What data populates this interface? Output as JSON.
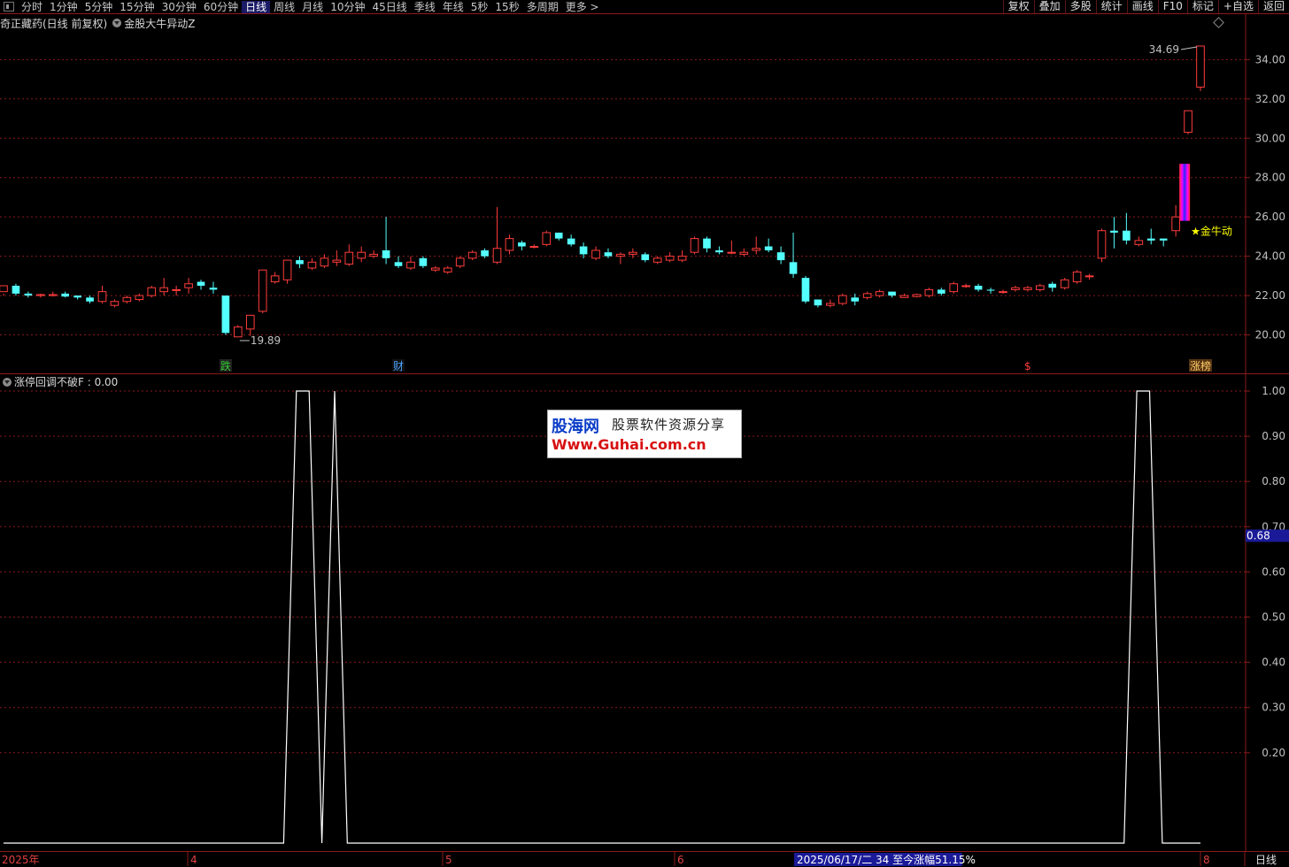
{
  "toolbar": {
    "periods": [
      "分时",
      "1分钟",
      "5分钟",
      "15分钟",
      "30分钟",
      "60分钟",
      "日线",
      "周线",
      "月线",
      "10分钟",
      "45日线",
      "季线",
      "年线",
      "5秒",
      "15秒",
      "多周期",
      "更多 >"
    ],
    "active_period": "日线",
    "right_buttons": [
      "复权",
      "叠加",
      "多股",
      "统计",
      "画线",
      "F10",
      "标记",
      "+自选",
      "返回"
    ]
  },
  "header": {
    "stock": "奇正藏药(日线 前复权)",
    "indicator": "金股大牛异动Z"
  },
  "sub_indicator": {
    "label": "涨停回调不破F : 0.00"
  },
  "watermark": {
    "line1_brand": "股海网",
    "line1_text": "股票软件资源分享",
    "line2": "Www.Guhai.com.cn"
  },
  "bottom_bar": {
    "year_label": "2025年",
    "months": [
      "4",
      "5",
      "6",
      "8"
    ],
    "status": "2025/06/17/二 34 至今涨幅51.15%",
    "period": "日线"
  },
  "colors": {
    "up": "#ff3c3c",
    "down": "#54ffff",
    "grid": "#8a1a1a",
    "axis_text": "#c0c0c0",
    "annotation_yellow": "#ffff00"
  },
  "chart_data": [
    {
      "type": "candlestick",
      "title": "奇正藏药(日线 前复权)",
      "y_ticks": [
        "34.00",
        "32.00",
        "30.00",
        "28.00",
        "26.00",
        "24.00",
        "22.00",
        "20.00"
      ],
      "ylim": [
        18.9,
        35.5
      ],
      "grid": true,
      "annotations": {
        "high_label": "34.69",
        "low_label": "19.89",
        "signal_label": "★金牛动",
        "markers": [
          "跌",
          "财",
          "$",
          "涨榜"
        ]
      },
      "candles": [
        [
          22.2,
          22.5,
          22.0,
          22.1
        ],
        [
          22.5,
          22.1,
          22.0,
          22.6
        ],
        [
          22.1,
          22.0,
          21.9,
          22.2
        ],
        [
          22.0,
          22.05,
          21.9,
          22.1
        ],
        [
          22.0,
          22.05,
          21.95,
          22.2
        ],
        [
          22.1,
          21.95,
          21.9,
          22.2
        ],
        [
          22.0,
          21.9,
          21.8,
          22.0
        ],
        [
          21.9,
          21.7,
          21.6,
          22.0
        ],
        [
          21.7,
          22.2,
          21.6,
          22.5
        ],
        [
          21.5,
          21.7,
          21.4,
          21.8
        ],
        [
          21.7,
          21.9,
          21.6,
          22.0
        ],
        [
          21.8,
          22.0,
          21.7,
          22.1
        ],
        [
          22.0,
          22.4,
          21.9,
          22.5
        ],
        [
          22.2,
          22.4,
          22.0,
          22.9
        ],
        [
          22.3,
          22.3,
          22.0,
          22.5
        ],
        [
          22.4,
          22.6,
          22.1,
          22.9
        ],
        [
          22.7,
          22.5,
          22.3,
          22.8
        ],
        [
          22.4,
          22.3,
          22.1,
          22.7
        ],
        [
          22.0,
          20.1,
          20.0,
          22.0
        ],
        [
          19.9,
          20.4,
          19.89,
          20.5
        ],
        [
          20.3,
          21.0,
          19.95,
          21.0
        ],
        [
          21.2,
          23.3,
          21.1,
          23.3
        ],
        [
          22.7,
          23.0,
          22.6,
          23.2
        ],
        [
          22.8,
          23.8,
          22.6,
          23.8
        ],
        [
          23.8,
          23.6,
          23.4,
          24.0
        ],
        [
          23.4,
          23.7,
          23.3,
          23.9
        ],
        [
          23.5,
          23.9,
          23.4,
          24.1
        ],
        [
          23.7,
          23.8,
          23.5,
          24.3
        ],
        [
          23.6,
          24.2,
          23.5,
          24.6
        ],
        [
          23.9,
          24.2,
          23.7,
          24.5
        ],
        [
          24.0,
          24.1,
          23.9,
          24.3
        ],
        [
          24.3,
          23.9,
          23.6,
          26.0
        ],
        [
          23.7,
          23.5,
          23.4,
          24.0
        ],
        [
          23.4,
          23.7,
          23.3,
          24.0
        ],
        [
          23.9,
          23.5,
          23.4,
          24.0
        ],
        [
          23.3,
          23.4,
          23.2,
          23.5
        ],
        [
          23.2,
          23.4,
          23.1,
          23.5
        ],
        [
          23.5,
          23.9,
          23.4,
          24.0
        ],
        [
          23.9,
          24.2,
          23.8,
          24.3
        ],
        [
          24.3,
          24.0,
          23.9,
          24.4
        ],
        [
          23.7,
          24.4,
          23.6,
          26.5
        ],
        [
          24.3,
          24.9,
          24.1,
          25.1
        ],
        [
          24.7,
          24.5,
          24.3,
          24.8
        ],
        [
          24.5,
          24.5,
          24.4,
          24.6
        ],
        [
          24.6,
          25.2,
          24.5,
          25.3
        ],
        [
          25.2,
          24.9,
          24.8,
          25.2
        ],
        [
          24.9,
          24.6,
          24.5,
          25.1
        ],
        [
          24.5,
          24.1,
          23.9,
          24.7
        ],
        [
          23.9,
          24.3,
          23.8,
          24.5
        ],
        [
          24.2,
          24.0,
          23.9,
          24.4
        ],
        [
          24.0,
          24.1,
          23.6,
          24.2
        ],
        [
          24.1,
          24.2,
          23.9,
          24.4
        ],
        [
          24.1,
          23.8,
          23.7,
          24.2
        ],
        [
          23.7,
          23.9,
          23.6,
          24.0
        ],
        [
          23.8,
          24.0,
          23.7,
          24.2
        ],
        [
          23.8,
          24.0,
          23.7,
          24.3
        ],
        [
          24.2,
          24.9,
          24.1,
          25.0
        ],
        [
          24.9,
          24.4,
          24.2,
          25.0
        ],
        [
          24.3,
          24.2,
          24.1,
          24.5
        ],
        [
          24.2,
          24.2,
          24.1,
          24.8
        ],
        [
          24.1,
          24.2,
          24.0,
          24.4
        ],
        [
          24.3,
          24.4,
          24.1,
          25.0
        ],
        [
          24.5,
          24.3,
          24.2,
          24.9
        ],
        [
          24.2,
          23.8,
          23.6,
          24.5
        ],
        [
          23.7,
          23.1,
          22.9,
          25.2
        ],
        [
          22.9,
          21.7,
          21.6,
          23.0
        ],
        [
          21.8,
          21.5,
          21.4,
          21.7
        ],
        [
          21.5,
          21.6,
          21.4,
          21.8
        ],
        [
          21.6,
          22.0,
          21.5,
          22.1
        ],
        [
          21.9,
          21.7,
          21.5,
          22.1
        ],
        [
          21.9,
          22.1,
          21.8,
          22.2
        ],
        [
          22.0,
          22.2,
          21.9,
          22.3
        ],
        [
          22.2,
          22.0,
          21.9,
          22.2
        ],
        [
          21.9,
          22.0,
          21.9,
          22.1
        ],
        [
          21.95,
          22.05,
          21.9,
          22.1
        ],
        [
          22.0,
          22.3,
          21.9,
          22.4
        ],
        [
          22.3,
          22.1,
          22.0,
          22.4
        ],
        [
          22.2,
          22.6,
          22.1,
          22.7
        ],
        [
          22.5,
          22.5,
          22.4,
          22.6
        ],
        [
          22.5,
          22.3,
          22.2,
          22.6
        ],
        [
          22.3,
          22.25,
          22.1,
          22.4
        ],
        [
          22.2,
          22.2,
          22.1,
          22.3
        ],
        [
          22.3,
          22.4,
          22.2,
          22.5
        ],
        [
          22.3,
          22.4,
          22.2,
          22.5
        ],
        [
          22.3,
          22.5,
          22.2,
          22.6
        ],
        [
          22.6,
          22.4,
          22.2,
          22.7
        ],
        [
          22.4,
          22.8,
          22.3,
          22.9
        ],
        [
          22.7,
          23.2,
          22.6,
          23.3
        ],
        [
          23.0,
          23.0,
          22.8,
          23.1
        ],
        [
          23.9,
          25.3,
          23.7,
          25.4
        ],
        [
          25.3,
          25.2,
          24.4,
          26.0
        ],
        [
          25.3,
          24.8,
          24.6,
          26.2
        ],
        [
          24.6,
          24.8,
          24.5,
          25.0
        ],
        [
          24.9,
          24.8,
          24.6,
          25.4
        ],
        [
          24.9,
          24.8,
          24.5,
          24.9
        ],
        [
          25.3,
          26.0,
          25.0,
          26.6
        ],
        [
          30.3,
          31.4,
          30.2,
          31.4
        ],
        [
          32.6,
          34.69,
          32.4,
          34.69
        ]
      ]
    },
    {
      "type": "line",
      "title": "涨停回调不破F",
      "y_ticks": [
        "1.00",
        "0.90",
        "0.80",
        "0.70",
        "0.60",
        "0.50",
        "0.40",
        "0.30",
        "0.20"
      ],
      "ylim": [
        0.0,
        1.0
      ],
      "current_value_label": "0.68",
      "values": [
        0,
        0,
        0,
        0,
        0,
        0,
        0,
        0,
        0,
        0,
        0,
        0,
        0,
        0,
        0,
        0,
        0,
        0,
        0,
        0,
        0,
        0,
        0,
        1,
        1,
        0,
        1,
        0,
        0,
        0,
        0,
        0,
        0,
        0,
        0,
        0,
        0,
        0,
        0,
        0,
        0,
        0,
        0,
        0,
        0,
        0,
        0,
        0,
        0,
        0,
        0,
        0,
        0,
        0,
        0,
        0,
        0,
        0,
        0,
        0,
        0,
        0,
        0,
        0,
        0,
        0,
        0,
        0,
        0,
        0,
        0,
        0,
        0,
        0,
        0,
        0,
        0,
        0,
        0,
        0,
        0,
        0,
        0,
        0,
        0,
        0,
        0,
        0,
        0,
        1,
        1,
        0,
        0,
        0,
        0
      ]
    }
  ]
}
